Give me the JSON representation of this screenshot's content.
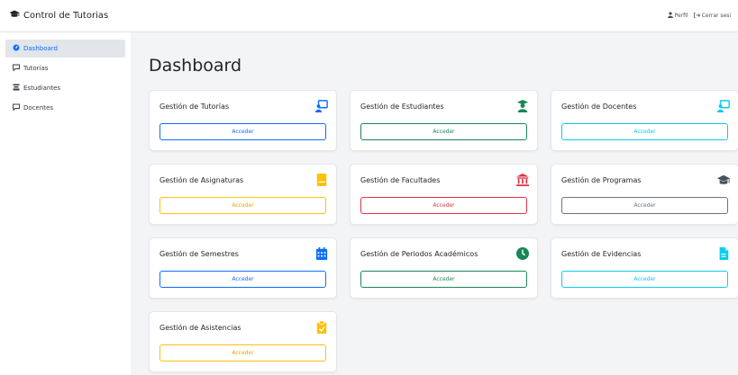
{
  "app": {
    "brand_title": "Control de Tutorias",
    "nav_profile": "Perfil",
    "nav_logout": "Cerrar sesi"
  },
  "sidebar": {
    "items": [
      {
        "label": "Dashboard",
        "icon": "dashboard-icon",
        "active": true
      },
      {
        "label": "Tutorías",
        "icon": "chat-icon",
        "active": false
      },
      {
        "label": "Estudiantes",
        "icon": "student-icon",
        "active": false
      },
      {
        "label": "Docentes",
        "icon": "chat-icon",
        "active": false
      }
    ]
  },
  "main": {
    "title": "Dashboard",
    "cards": [
      {
        "title": "Gestión de Tutorías",
        "button": "Acceder",
        "icon": "tutor-board-icon",
        "variant": "primary",
        "color": "#0d6efd"
      },
      {
        "title": "Gestión de Estudiantes",
        "button": "Acceder",
        "icon": "graduate-icon",
        "variant": "success",
        "color": "#198754"
      },
      {
        "title": "Gestión de Docentes",
        "button": "Acceder",
        "icon": "teacher-board-icon",
        "variant": "info",
        "color": "#0dcaf0"
      },
      {
        "title": "Gestión de Asignaturas",
        "button": "Acceder",
        "icon": "book-icon",
        "variant": "warning",
        "color": "#ffc107"
      },
      {
        "title": "Gestión de Facultades",
        "button": "Acceder",
        "icon": "university-icon",
        "variant": "danger",
        "color": "#dc3545"
      },
      {
        "title": "Gestión de Programas",
        "button": "Acceder",
        "icon": "graduation-cap-icon",
        "variant": "secondary",
        "color": "#495057"
      },
      {
        "title": "Gestión de Semestres",
        "button": "Acceder",
        "icon": "calendar-icon",
        "variant": "primary",
        "color": "#0d6efd"
      },
      {
        "title": "Gestión de Periodos Académicos",
        "button": "Acceder",
        "icon": "clock-icon",
        "variant": "success",
        "color": "#198754"
      },
      {
        "title": "Gestión de Evidencias",
        "button": "Acceder",
        "icon": "file-icon",
        "variant": "info",
        "color": "#0dcaf0"
      },
      {
        "title": "Gestión de Asistencias",
        "button": "Acceder",
        "icon": "clipboard-check-icon",
        "variant": "warning",
        "color": "#ffc107"
      }
    ]
  }
}
